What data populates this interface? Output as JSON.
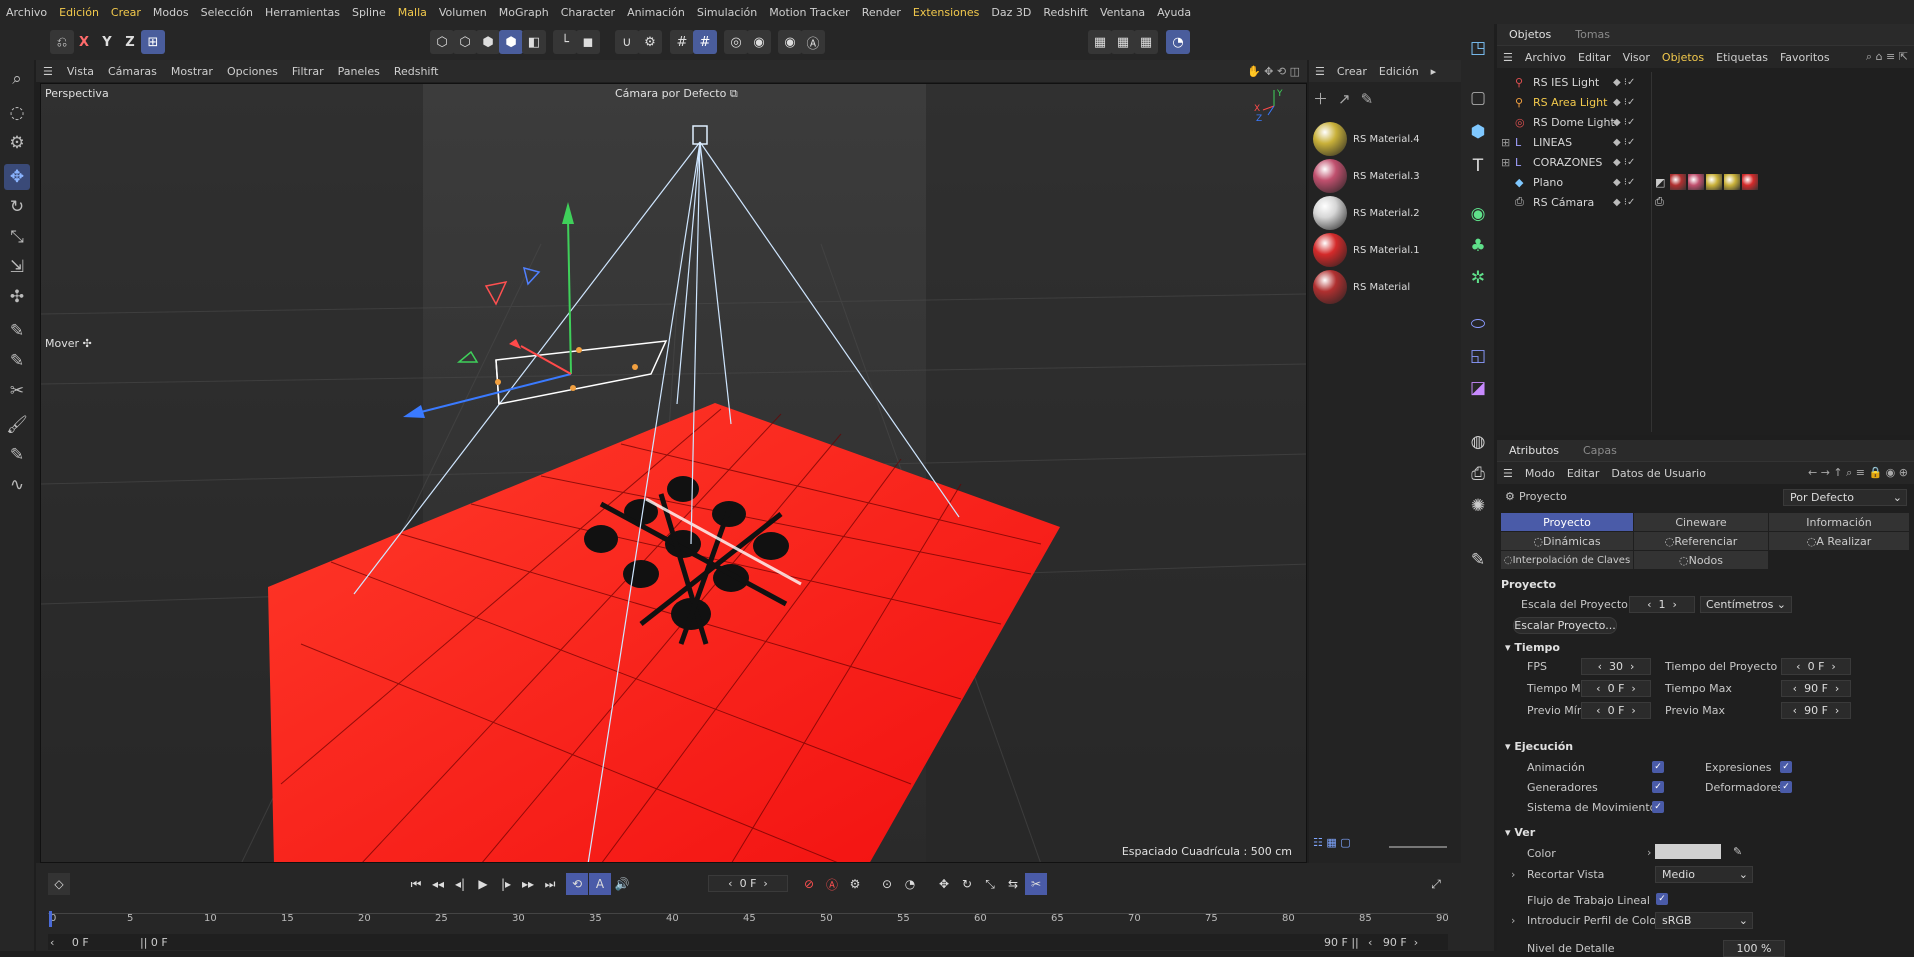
{
  "menubar": {
    "items": [
      "Archivo",
      "Edición",
      "Crear",
      "Modos",
      "Selección",
      "Herramientas",
      "Spline",
      "Malla",
      "Volumen",
      "MoGraph",
      "Character",
      "Animación",
      "Simulación",
      "Motion Tracker",
      "Render",
      "Extensiones",
      "Daz 3D",
      "Redshift",
      "Ventana",
      "Ayuda"
    ],
    "highlighted": [
      "Edición",
      "Crear",
      "Malla",
      "Extensiones"
    ]
  },
  "toolbar": {
    "axis_x": "X",
    "axis_y": "Y",
    "axis_z": "Z"
  },
  "viewport": {
    "menu": [
      "Vista",
      "Cámaras",
      "Mostrar",
      "Opciones",
      "Filtrar",
      "Paneles",
      "Redshift"
    ],
    "label": "Perspectiva",
    "camera": "Cámara por Defecto",
    "tool_label": "Mover",
    "grid_info": "Espaciado Cuadrícula : 500 cm",
    "axes": [
      "Y",
      "X",
      "Z"
    ]
  },
  "materials": {
    "menu": [
      "Crear",
      "Edición"
    ],
    "items": [
      {
        "name": "RS Material.4",
        "color": "#c9b13a"
      },
      {
        "name": "RS Material.3",
        "color": "#c0506e"
      },
      {
        "name": "RS Material.2",
        "color": "#d6d6d6"
      },
      {
        "name": "RS Material.1",
        "color": "#d42a2a"
      },
      {
        "name": "RS Material",
        "color": "#b03030"
      }
    ]
  },
  "objects": {
    "tabs": [
      "Objetos",
      "Tomas"
    ],
    "menu": [
      "Archivo",
      "Editar",
      "Visor",
      "Objetos",
      "Etiquetas",
      "Favoritos"
    ],
    "items": [
      {
        "name": "RS IES Light",
        "icon": "ies-light-icon",
        "color": "#e05050"
      },
      {
        "name": "RS Area Light",
        "icon": "area-light-icon",
        "color": "#f2a040"
      },
      {
        "name": "RS Dome Light",
        "icon": "dome-light-icon",
        "color": "#e05050"
      },
      {
        "name": "LINEAS",
        "icon": "null-group-icon",
        "color": "#a0a0ff"
      },
      {
        "name": "CORAZONES",
        "icon": "null-group-icon",
        "color": "#a0a0ff"
      },
      {
        "name": "Plano",
        "icon": "plane-icon",
        "color": "#7fc8ff"
      },
      {
        "name": "RS Cámara",
        "icon": "camera-icon",
        "color": "#c8c8c8"
      }
    ],
    "plano_tags": [
      "#b03030",
      "#c0506e",
      "#c9b13a",
      "#c9b13a",
      "#d42a2a"
    ]
  },
  "attributes": {
    "tabs": [
      "Atributos",
      "Capas"
    ],
    "menu": [
      "Modo",
      "Editar",
      "Datos de Usuario"
    ],
    "object": "Proyecto",
    "preset": "Por Defecto",
    "tabs_row1": [
      "Proyecto",
      "Cineware",
      "Información"
    ],
    "tabs_row2": [
      "Dinámicas",
      "Referenciar",
      "A Realizar"
    ],
    "tabs_row3": [
      "Interpolación de Claves",
      "Nodos"
    ],
    "section_title": "Proyecto",
    "scale_label": "Escala del Proyecto",
    "scale_value": "1",
    "scale_unit": "Centímetros",
    "scale_button": "Escalar Proyecto...",
    "tiempo": {
      "title": "Tiempo",
      "fps_label": "FPS",
      "fps": "30",
      "tproj_label": "Tiempo del Proyecto",
      "tproj": "0 F",
      "tmin_label": "Tiempo Mín",
      "tmin": "0 F",
      "tmax_label": "Tiempo Max",
      "tmax": "90 F",
      "pmin_label": "Previo Mín",
      "pmin": "0 F",
      "pmax_label": "Previo Max",
      "pmax": "90 F"
    },
    "ejecucion": {
      "title": "Ejecución",
      "anim": "Animación",
      "expr": "Expresiones",
      "gen": "Generadores",
      "def": "Deformadores",
      "mov": "Sistema de Movimiento"
    },
    "ver": {
      "title": "Ver",
      "color": "Color",
      "crop": "Recortar Vista",
      "crop_val": "Medio",
      "linear": "Flujo de Trabajo Lineal",
      "profile": "Introducir Perfil de Color",
      "profile_val": "sRGB",
      "detail": "Nivel de Detalle",
      "detail_val": "100 %"
    }
  },
  "timeline": {
    "current": "0 F",
    "ticks": [
      "0",
      "5",
      "10",
      "15",
      "20",
      "25",
      "30",
      "35",
      "40",
      "45",
      "50",
      "55",
      "60",
      "65",
      "70",
      "75",
      "80",
      "85",
      "90"
    ],
    "start": "0 F",
    "start2": "0 F",
    "end": "90 F",
    "end2": "90 F"
  }
}
